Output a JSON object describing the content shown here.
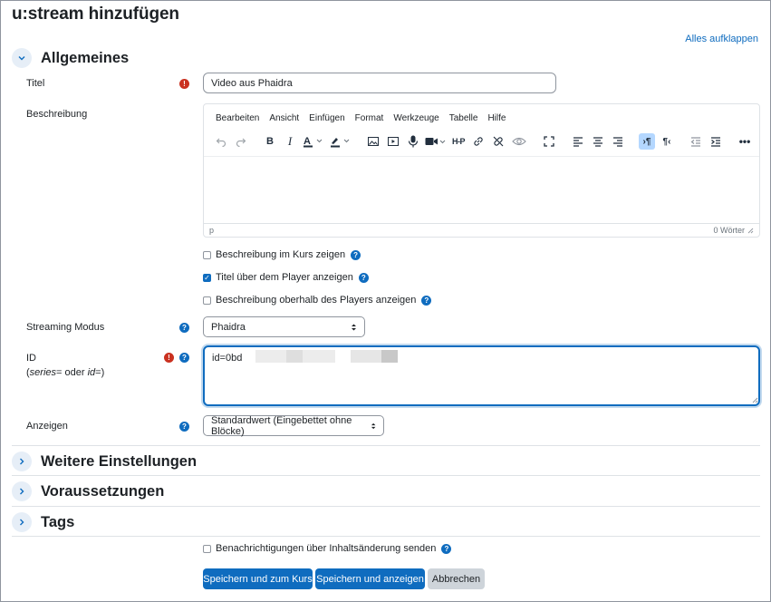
{
  "page": {
    "title": "u:stream hinzufügen",
    "expand_all": "Alles aufklappen"
  },
  "sections": {
    "general": "Allgemeines",
    "more_settings": "Weitere Einstellungen",
    "prerequisites": "Voraussetzungen",
    "tags": "Tags"
  },
  "fields": {
    "title": {
      "label": "Titel",
      "value": "Video aus Phaidra"
    },
    "description": {
      "label": "Beschreibung"
    },
    "streaming_mode": {
      "label": "Streaming Modus",
      "value": "Phaidra"
    },
    "id": {
      "label": "ID",
      "hint_prefix": "(",
      "hint_series": "series",
      "hint_middle": "= oder ",
      "hint_id": "id",
      "hint_suffix": "=)",
      "value": "id=0bd"
    },
    "display": {
      "label": "Anzeigen",
      "value": "Standardwert (Eingebettet ohne Blöcke)"
    }
  },
  "editor": {
    "menu": [
      "Bearbeiten",
      "Ansicht",
      "Einfügen",
      "Format",
      "Werkzeuge",
      "Tabelle",
      "Hilfe"
    ],
    "status_path": "p",
    "word_count": "0 Wörter"
  },
  "checkboxes": {
    "show_description": {
      "label": "Beschreibung im Kurs zeigen",
      "checked": false
    },
    "title_above_player": {
      "label": "Titel über dem Player anzeigen",
      "checked": true
    },
    "description_above_player": {
      "label": "Beschreibung oberhalb des Players anzeigen",
      "checked": false
    },
    "notify_changes": {
      "label": "Benachrichtigungen über Inhaltsänderung senden",
      "checked": false
    }
  },
  "buttons": {
    "save_return": "Speichern und zum Kurs",
    "save_display": "Speichern und anzeigen",
    "cancel": "Abbrechen"
  },
  "icons": {
    "required": "!",
    "help": "?",
    "check": "✓"
  },
  "colors": {
    "primary": "#0f6cbf",
    "required": "#ca3120",
    "secondary_button": "#ced4da",
    "active_tool": "#b4d7ff"
  }
}
